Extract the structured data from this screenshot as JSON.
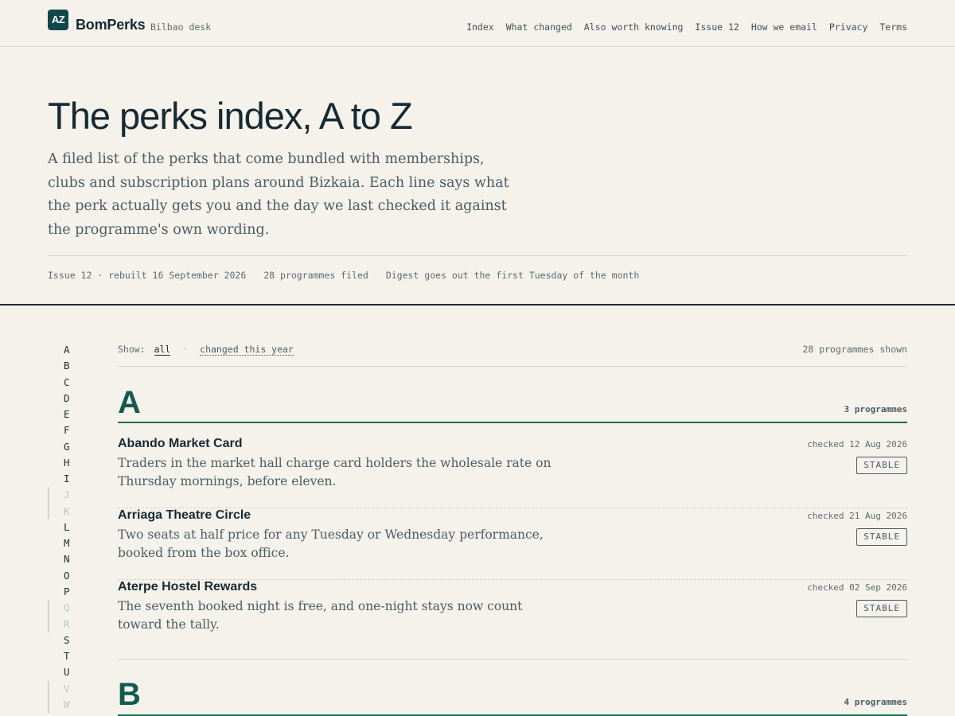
{
  "header": {
    "logo_text": "AZ",
    "brand": "BomPerks",
    "desk": "Bilbao desk",
    "nav": [
      "Index",
      "What changed",
      "Also worth knowing",
      "Issue 12",
      "How we email",
      "Privacy",
      "Terms"
    ]
  },
  "hero": {
    "title": "The perks index, A to Z",
    "lede": "A filed list of the perks that come bundled with memberships, clubs and subscription plans around Bizkaia. Each line says what the perk actually gets you and the day we last checked it against the programme's own wording.",
    "meta": {
      "issue": "Issue 12 · rebuilt 16 September 2026",
      "filed": "28 programmes filed",
      "digest": "Digest goes out the first Tuesday of the month"
    }
  },
  "rail": {
    "letters": [
      {
        "letter": "A",
        "has_entries": true
      },
      {
        "letter": "B",
        "has_entries": true
      },
      {
        "letter": "C",
        "has_entries": true
      },
      {
        "letter": "D",
        "has_entries": true
      },
      {
        "letter": "E",
        "has_entries": true
      },
      {
        "letter": "F",
        "has_entries": true
      },
      {
        "letter": "G",
        "has_entries": true
      },
      {
        "letter": "H",
        "has_entries": true
      },
      {
        "letter": "I",
        "has_entries": true
      },
      {
        "letter": "J",
        "has_entries": false
      },
      {
        "letter": "K",
        "has_entries": false
      },
      {
        "letter": "L",
        "has_entries": true
      },
      {
        "letter": "M",
        "has_entries": true
      },
      {
        "letter": "N",
        "has_entries": true
      },
      {
        "letter": "O",
        "has_entries": true
      },
      {
        "letter": "P",
        "has_entries": true
      },
      {
        "letter": "Q",
        "has_entries": false
      },
      {
        "letter": "R",
        "has_entries": false
      },
      {
        "letter": "S",
        "has_entries": true
      },
      {
        "letter": "T",
        "has_entries": true
      },
      {
        "letter": "U",
        "has_entries": true
      },
      {
        "letter": "V",
        "has_entries": false
      },
      {
        "letter": "W",
        "has_entries": false
      }
    ]
  },
  "filters": {
    "show_label": "Show:",
    "all_label": "all",
    "changed_label": "changed this year",
    "shown_count": "28 programmes shown"
  },
  "groups": [
    {
      "letter": "A",
      "count_label": "3 programmes",
      "entries": [
        {
          "name": "Abando Market Card",
          "description": "Traders in the market hall charge card holders the wholesale rate on Thursday mornings, before eleven.",
          "checked": "checked 12 Aug 2026",
          "status": "STABLE"
        },
        {
          "name": "Arriaga Theatre Circle",
          "description": "Two seats at half price for any Tuesday or Wednesday performance, booked from the box office.",
          "checked": "checked 21 Aug 2026",
          "status": "STABLE"
        },
        {
          "name": "Aterpe Hostel Rewards",
          "description": "The seventh booked night is free, and one-night stays now count toward the tally.",
          "checked": "checked 02 Sep 2026",
          "status": "STABLE"
        }
      ]
    },
    {
      "letter": "B",
      "count_label": "4 programmes",
      "entries": []
    }
  ],
  "colors": {
    "background": "#f5f2eb",
    "accent": "#145a4e",
    "ink": "#172a33",
    "muted": "#4a5c63"
  }
}
